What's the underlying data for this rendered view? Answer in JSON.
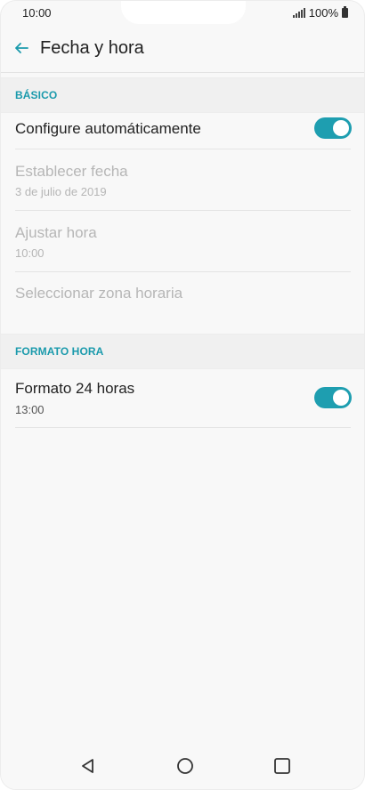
{
  "status": {
    "time": "10:00",
    "battery": "100%"
  },
  "header": {
    "title": "Fecha y hora",
    "back_icon": "arrow-left-icon"
  },
  "sections": [
    {
      "title": "BÁSICO",
      "items": [
        {
          "title": "Configure automáticamente",
          "toggle": "on"
        },
        {
          "title": "Establecer fecha",
          "subtitle": "3 de julio de 2019"
        },
        {
          "title": "Ajustar hora",
          "subtitle": "10:00"
        },
        {
          "title": "Seleccionar zona horaria"
        }
      ]
    },
    {
      "title": "FORMATO HORA",
      "items": [
        {
          "title": "Formato 24 horas",
          "subtitle": "13:00",
          "toggle": "on"
        }
      ]
    }
  ],
  "navigation": {
    "back": "triangle-back-icon",
    "home": "circle-home-icon",
    "recent": "square-recents-icon"
  },
  "colors": {
    "accent": "#1e9eb0",
    "disabled_text": "#b6b6b6"
  }
}
